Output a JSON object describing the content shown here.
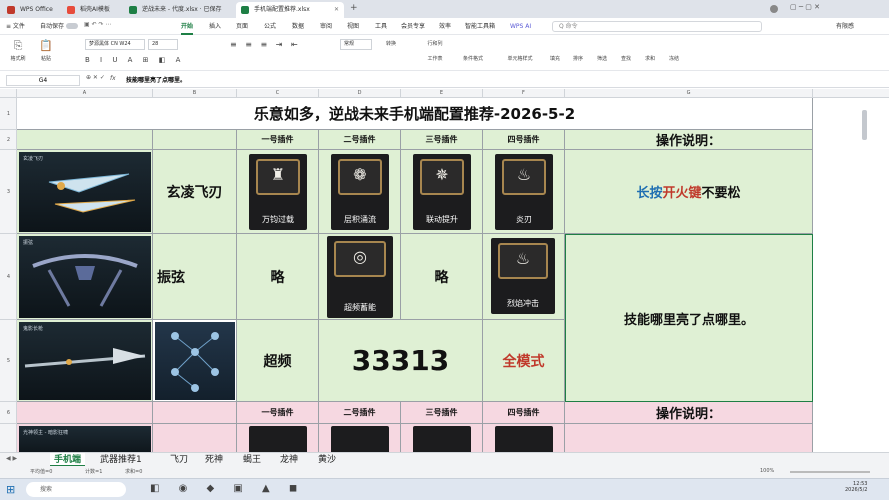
{
  "tabs": [
    {
      "label": "WPS Office",
      "color": "#c0392b"
    },
    {
      "label": "稻壳AI模板",
      "color": "#e74c3c"
    },
    {
      "label": "逆战未来 - 代度.xlsx · 已保存",
      "color": "#1e7f45"
    },
    {
      "label": "手机端配置推荐.xlsx",
      "color": "#1e7f45"
    }
  ],
  "menu": {
    "file": "≡ 文件",
    "autosave": "自动保存",
    "items": [
      "开始",
      "插入",
      "页面",
      "公式",
      "数据",
      "审阅",
      "视图",
      "工具",
      "会员专享",
      "效率",
      "智能工具箱"
    ],
    "wps_ai": "WPS AI",
    "search_placeholder": "Q 命令",
    "share": "有限感"
  },
  "ribbon": {
    "format_painter": "格式刷",
    "paste": "粘贴",
    "font_name": "梦源黑体 CN W24",
    "font_size": "28",
    "normal": "常规",
    "convert": "转换",
    "row_col": "行和列",
    "worksheet": "工作表",
    "conditional": "条件格式",
    "fill_color": "填充",
    "cell_style": "单元格样式",
    "sort": "排序",
    "filter": "筛选",
    "find": "查找",
    "sum": "求和",
    "freeze": "冻结"
  },
  "formula_bar": {
    "cell_ref": "G4",
    "fx": "fx",
    "content": "技能哪里亮了点哪里。"
  },
  "columns": [
    "A",
    "B",
    "C",
    "D",
    "E",
    "F",
    "G"
  ],
  "rows": [
    "1",
    "2",
    "3",
    "4",
    "5",
    "6"
  ],
  "sheet": {
    "title": "乐意如多，逆战未来手机端配置推荐-2026-5-2",
    "plug_headers": [
      "一号插件",
      "二号插件",
      "三号插件",
      "四号插件"
    ],
    "op_header": "操作说明：",
    "weapon1": {
      "caption": "玄凌飞刃",
      "name": "玄凌飞刃",
      "skills": [
        "万钧过载",
        "层积涌流",
        "联动提升",
        "炎刃"
      ],
      "glyphs": [
        "♜",
        "❁",
        "✵",
        "♨"
      ]
    },
    "weapon2": {
      "caption": "振弦",
      "name": "振弦",
      "c": "略",
      "d_label": "超频蓄能",
      "d_glyph": "◎",
      "e": "略",
      "f_label": "烈焰冲击",
      "f_glyph": "♨"
    },
    "weapon3": {
      "caption": "鬼影长枪",
      "name": "超频",
      "code": "33313",
      "mode": "全模式"
    },
    "op1": {
      "a": "长按",
      "b": "开火键",
      "c": "不要松"
    },
    "op2": "技能哪里亮了点哪里。",
    "row6_caption": "光神领主 - 暗影狂啸"
  },
  "sheet_tabs": [
    "手机端",
    "武器推荐1",
    "飞刀",
    "死神",
    "蝎王",
    "龙神",
    "黄沙"
  ],
  "status": {
    "avg": "平均值=0",
    "count": "计数=1",
    "sum": "求和=0",
    "zoom": "100%"
  },
  "taskbar": {
    "search": "搜索",
    "time": "12:53",
    "date": "2026/5/2"
  },
  "colors": {
    "accent": "#1e7f45",
    "blue_text": "#1f6fb2",
    "red_text": "#c0392b",
    "green_fill": "#dff0d4",
    "pink_fill": "#f6d8e1"
  }
}
